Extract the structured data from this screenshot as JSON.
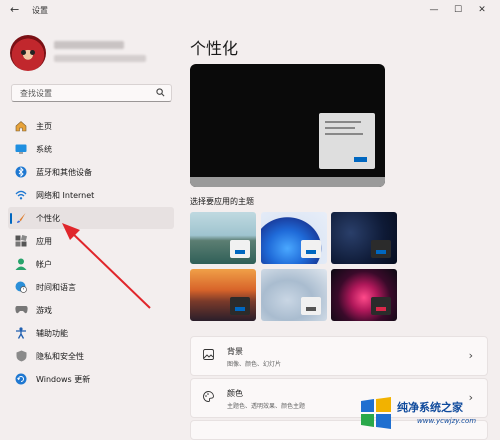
{
  "window": {
    "title": "设置",
    "back": "←",
    "minimize": "—",
    "maximize": "☐",
    "close": "✕"
  },
  "search": {
    "placeholder": "查找设置",
    "icon": "search-icon"
  },
  "sidebar": {
    "items": [
      {
        "label": "主页",
        "icon": "home-icon"
      },
      {
        "label": "系统",
        "icon": "display-icon"
      },
      {
        "label": "蓝牙和其他设备",
        "icon": "bluetooth-icon"
      },
      {
        "label": "网络和 Internet",
        "icon": "wifi-icon"
      },
      {
        "label": "个性化",
        "icon": "brush-icon",
        "active": true
      },
      {
        "label": "应用",
        "icon": "apps-icon"
      },
      {
        "label": "帐户",
        "icon": "account-icon"
      },
      {
        "label": "时间和语言",
        "icon": "globe-clock-icon"
      },
      {
        "label": "游戏",
        "icon": "gamepad-icon"
      },
      {
        "label": "辅助功能",
        "icon": "accessibility-icon"
      },
      {
        "label": "隐私和安全性",
        "icon": "shield-icon"
      },
      {
        "label": "Windows 更新",
        "icon": "update-icon"
      }
    ]
  },
  "main": {
    "title": "个性化",
    "theme_section_label": "选择要应用的主题",
    "cards": [
      {
        "title": "背景",
        "subtitle": "图像、颜色、幻灯片",
        "icon": "image-icon",
        "chevron": "›"
      },
      {
        "title": "颜色",
        "subtitle": "主题色、透明效果、颜色主题",
        "icon": "palette-icon",
        "chevron": "›"
      }
    ]
  },
  "colors": {
    "accent": "#0067c0",
    "arrow": "#e0262b"
  },
  "watermark": {
    "text": "纯净系统之家",
    "url": "www.ycwjzy.com"
  }
}
